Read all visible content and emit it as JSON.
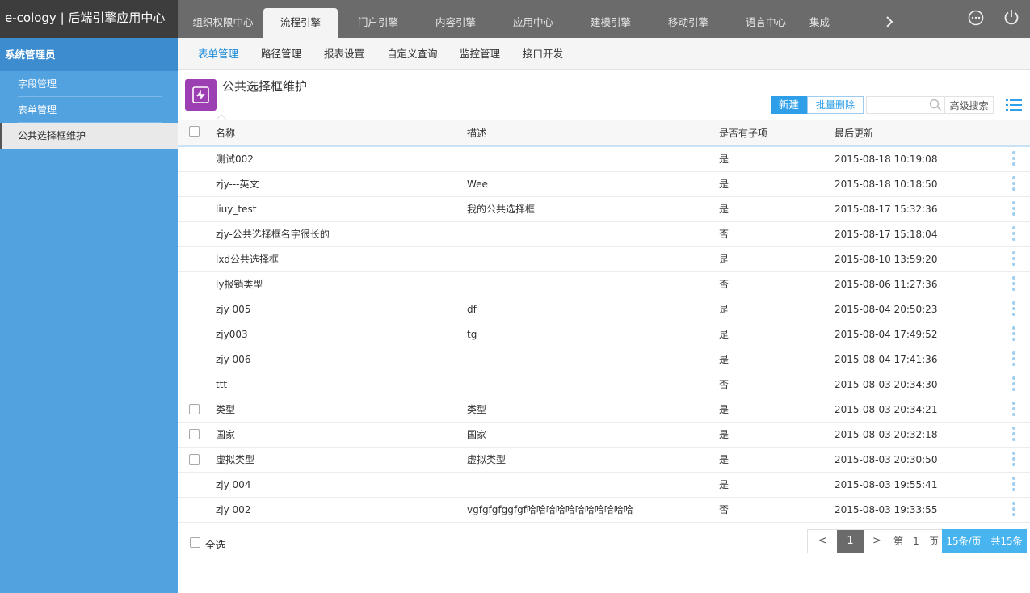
{
  "app": {
    "title": "e-cology | 后端引擎应用中心"
  },
  "top_tabs": [
    {
      "label": "组织权限中心"
    },
    {
      "label": "流程引擎"
    },
    {
      "label": "门户引擎"
    },
    {
      "label": "内容引擎"
    },
    {
      "label": "应用中心"
    },
    {
      "label": "建模引擎"
    },
    {
      "label": "移动引擎"
    },
    {
      "label": "语言中心"
    },
    {
      "label": "集成"
    }
  ],
  "top_icons": {
    "more": "more-icon",
    "power": "power-icon"
  },
  "sidebar": {
    "section_title": "系统管理员",
    "items": [
      {
        "label": "字段管理"
      },
      {
        "label": "表单管理"
      },
      {
        "label": "公共选择框维护"
      }
    ]
  },
  "subnav": [
    {
      "label": "表单管理"
    },
    {
      "label": "路径管理"
    },
    {
      "label": "报表设置"
    },
    {
      "label": "自定义查询"
    },
    {
      "label": "监控管理"
    },
    {
      "label": "接口开发"
    }
  ],
  "page": {
    "title": "公共选择框维护",
    "new_label": "新建",
    "batch_delete_label": "批量删除",
    "search_placeholder": "",
    "advanced_search_label": "高级搜索"
  },
  "table": {
    "headers": {
      "name": "名称",
      "desc": "描述",
      "has_child": "是否有子项",
      "updated": "最后更新"
    },
    "rows": [
      {
        "name": "测试002",
        "desc": "",
        "has_child": "是",
        "updated": "2015-08-18 10:19:08",
        "checkbox": false
      },
      {
        "name": "zjy---英文",
        "desc": "Wee",
        "has_child": "是",
        "updated": "2015-08-18 10:18:50",
        "checkbox": false
      },
      {
        "name": "liuy_test",
        "desc": "我的公共选择框",
        "has_child": "是",
        "updated": "2015-08-17 15:32:36",
        "checkbox": false
      },
      {
        "name": "zjy-公共选择框名字很长的",
        "desc": "",
        "has_child": "否",
        "updated": "2015-08-17 15:18:04",
        "checkbox": false
      },
      {
        "name": "lxd公共选择框",
        "desc": "",
        "has_child": "是",
        "updated": "2015-08-10 13:59:20",
        "checkbox": false
      },
      {
        "name": "ly报销类型",
        "desc": "",
        "has_child": "否",
        "updated": "2015-08-06 11:27:36",
        "checkbox": false
      },
      {
        "name": "zjy 005",
        "desc": "df",
        "has_child": "是",
        "updated": "2015-08-04 20:50:23",
        "checkbox": false
      },
      {
        "name": "zjy003",
        "desc": "tg",
        "has_child": "是",
        "updated": "2015-08-04 17:49:52",
        "checkbox": false
      },
      {
        "name": "zjy 006",
        "desc": "",
        "has_child": "是",
        "updated": "2015-08-04 17:41:36",
        "checkbox": false
      },
      {
        "name": "ttt",
        "desc": "",
        "has_child": "否",
        "updated": "2015-08-03 20:34:30",
        "checkbox": false
      },
      {
        "name": "类型",
        "desc": "类型",
        "has_child": "是",
        "updated": "2015-08-03 20:34:21",
        "checkbox": true
      },
      {
        "name": "国家",
        "desc": "国家",
        "has_child": "是",
        "updated": "2015-08-03 20:32:18",
        "checkbox": true
      },
      {
        "name": "虚拟类型",
        "desc": "虚拟类型",
        "has_child": "是",
        "updated": "2015-08-03 20:30:50",
        "checkbox": true
      },
      {
        "name": "zjy 004",
        "desc": "",
        "has_child": "是",
        "updated": "2015-08-03 19:55:41",
        "checkbox": false
      },
      {
        "name": "zjy 002",
        "desc": "vgfgfgfggfgf哈哈哈哈哈哈哈哈哈哈哈",
        "has_child": "否",
        "updated": "2015-08-03 19:33:55",
        "checkbox": false
      }
    ]
  },
  "footer": {
    "select_all_label": "全选",
    "pager": {
      "prev": "<",
      "current": "1",
      "next": ">",
      "page_prefix": "第",
      "page_value": "1",
      "page_suffix": "页",
      "info": "15条/页 | 共15条"
    }
  },
  "colors": {
    "topbar": "#6b6b6b",
    "brand_bg": "#3d3d3d",
    "sidebar": "#52a2e0",
    "accent": "#2e9fe8",
    "page_icon": "#9b3fb2"
  }
}
